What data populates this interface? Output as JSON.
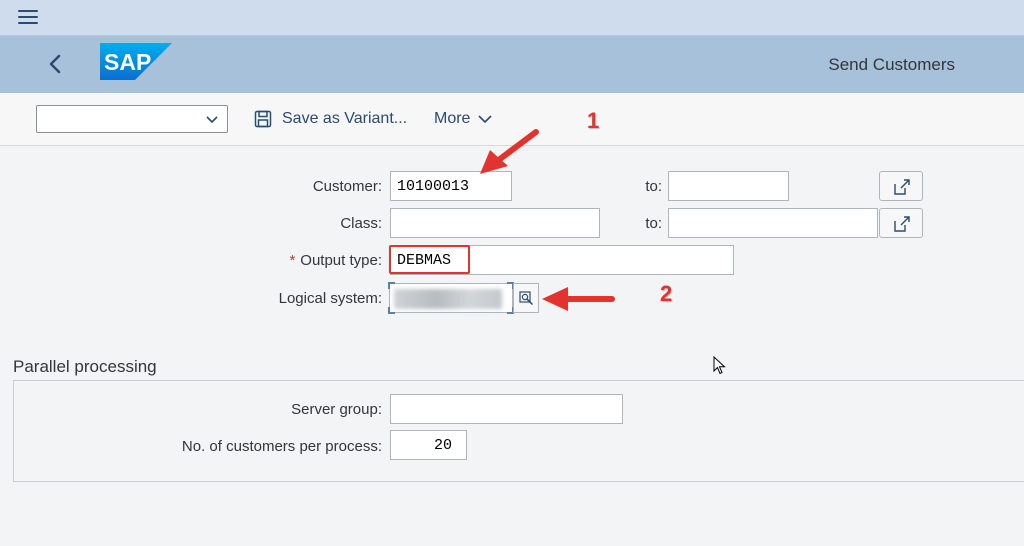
{
  "shell": {
    "title": "Send Customers",
    "logo_text": "SAP",
    "brand_color": "#0a6ed1"
  },
  "toolbar": {
    "variant_value": "",
    "save_variant_label": "Save as Variant...",
    "more_label": "More"
  },
  "form": {
    "customer_label": "Customer:",
    "customer_value": "10100013",
    "customer_to_label": "to:",
    "customer_to_value": "",
    "class_label": "Class:",
    "class_value": "",
    "class_to_label": "to:",
    "class_to_value": "",
    "output_type_required": "*",
    "output_type_label": "Output type:",
    "output_type_value": "DEBMAS",
    "logical_system_label": "Logical system:"
  },
  "parallel": {
    "section_title": "Parallel processing",
    "server_group_label": "Server group:",
    "server_group_value": "",
    "customers_per_process_label": "No. of customers per process:",
    "customers_per_process_value": "20"
  },
  "annotations": {
    "marker_1": "1",
    "marker_2": "2",
    "color": "#e3332f"
  }
}
